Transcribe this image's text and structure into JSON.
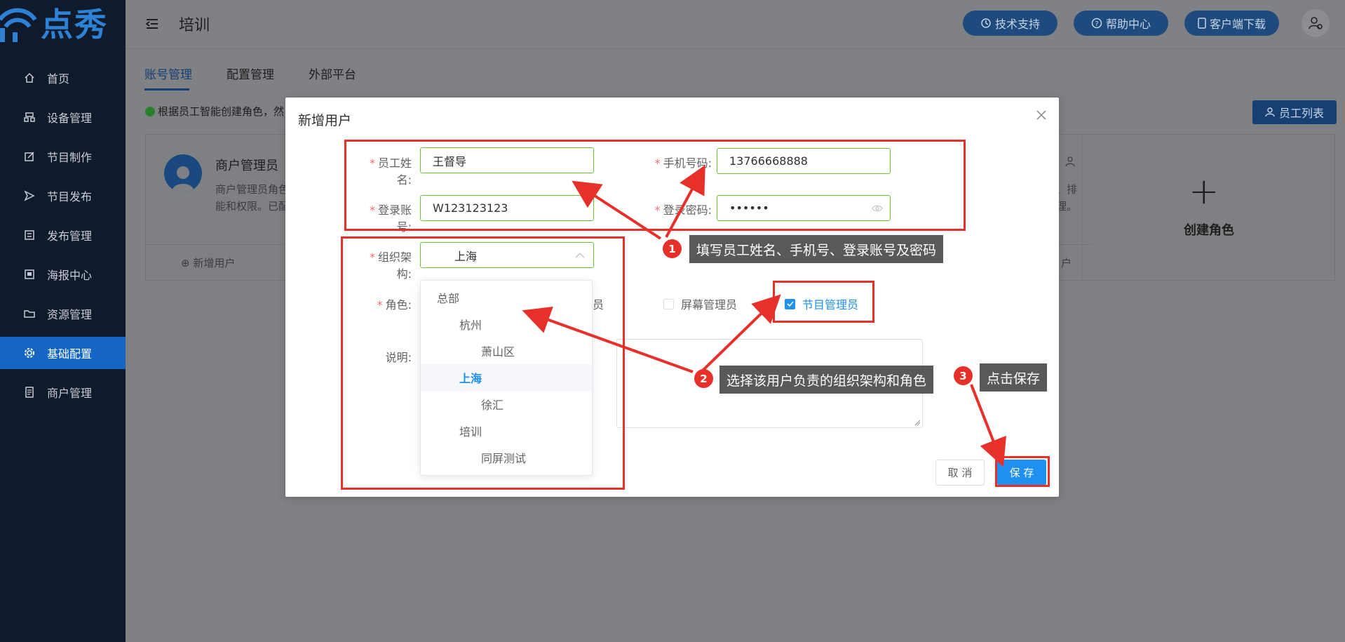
{
  "app": {
    "logo_text": "点秀",
    "page_title": "培训"
  },
  "header": {
    "tech_support": "技术支持",
    "help_center": "帮助中心",
    "client_download": "客户端下载"
  },
  "sidebar": {
    "items": [
      {
        "label": "首页",
        "icon": "home-icon"
      },
      {
        "label": "设备管理",
        "icon": "device-icon"
      },
      {
        "label": "节目制作",
        "icon": "edit-icon"
      },
      {
        "label": "节目发布",
        "icon": "send-icon"
      },
      {
        "label": "发布管理",
        "icon": "list-icon"
      },
      {
        "label": "海报中心",
        "icon": "poster-icon"
      },
      {
        "label": "资源管理",
        "icon": "folder-icon"
      },
      {
        "label": "基础配置",
        "icon": "gear-icon",
        "active": true
      },
      {
        "label": "商户管理",
        "icon": "merchant-icon"
      }
    ]
  },
  "tabs": [
    {
      "label": "账号管理",
      "active": true
    },
    {
      "label": "配置管理"
    },
    {
      "label": "外部平台"
    }
  ],
  "background": {
    "info_text": "根据员工智能创建角色，然",
    "staff_list_button": "员工列表",
    "role_card": {
      "title": "商户管理员",
      "desc_line1": "商户管理员角色",
      "desc_line2": "能和权限。已配",
      "add_user": "新增用户",
      "right_desc_line1": "、排",
      "right_desc_line2": "理。",
      "right_bottom": "户"
    },
    "create_role": "创建角色"
  },
  "dialog": {
    "title": "新增用户",
    "fields": {
      "name_label": "员工姓名:",
      "name_value": "王督导",
      "phone_label": "手机号码:",
      "phone_value": "13766668888",
      "account_label": "登录账号:",
      "account_value": "W123123123",
      "password_label": "登录密码:",
      "password_value": "••••••",
      "org_label": "组织架构:",
      "org_value": "上海",
      "role_label": "角色:",
      "desc_label": "说明:"
    },
    "roles": [
      {
        "label": "理员",
        "checked": false
      },
      {
        "label": "屏幕管理员",
        "checked": false
      },
      {
        "label": "节目管理员",
        "checked": true
      }
    ],
    "cancel": "取 消",
    "save": "保 存"
  },
  "org_tree": [
    {
      "label": "总部",
      "level": 0
    },
    {
      "label": "杭州",
      "level": 1
    },
    {
      "label": "萧山区",
      "level": 2
    },
    {
      "label": "上海",
      "level": 1,
      "selected": true
    },
    {
      "label": "徐汇",
      "level": 2
    },
    {
      "label": "培训",
      "level": 1
    },
    {
      "label": "同屏测试",
      "level": 2
    }
  ],
  "annotations": [
    {
      "number": "1",
      "text": "填写员工姓名、手机号、登录账号及密码"
    },
    {
      "number": "2",
      "text": "选择该用户负责的组织架构和角色"
    },
    {
      "number": "3",
      "text": "点击保存"
    }
  ],
  "colors": {
    "primary": "#1f8ff0",
    "sidebar_bg": "#0f1a2c",
    "sidebar_active": "#1466c2",
    "annotation_red": "#e8302a",
    "input_border_valid": "#67c23a"
  }
}
